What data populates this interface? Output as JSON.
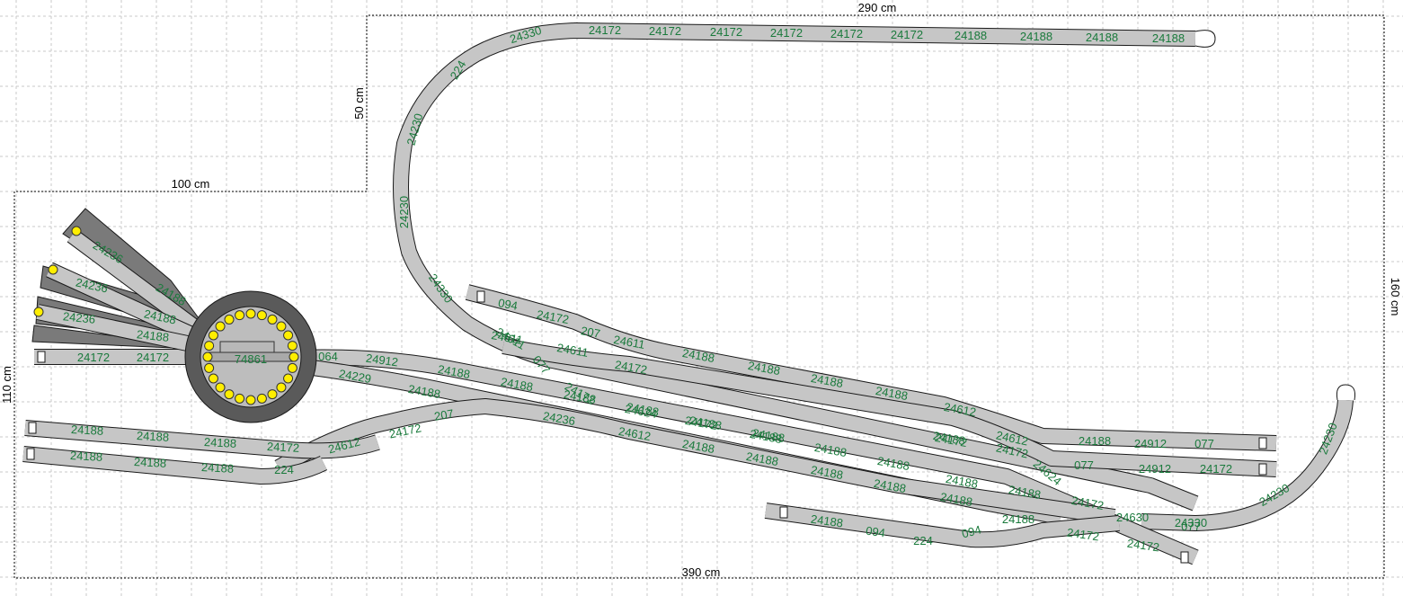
{
  "dimensions": {
    "top_width": "290 cm",
    "step_height": "50 cm",
    "step_width": "100 cm",
    "right_height": "160 cm",
    "left_height": "110 cm",
    "bottom_width": "390 cm"
  },
  "turntable": {
    "part": "74861"
  },
  "parts": {
    "top_loop": [
      "24330",
      "24172",
      "24172",
      "24172",
      "24172",
      "24172",
      "24172",
      "24188",
      "24188",
      "24188",
      "24188"
    ],
    "left_curve": [
      "224",
      "24230",
      "24230",
      "24330"
    ],
    "right_curve": [
      "24230",
      "24230",
      "24330"
    ],
    "fan": [
      "24236",
      "24188",
      "24236",
      "24188",
      "24236",
      "24188"
    ],
    "turntable_left": [
      "24172",
      "24172"
    ],
    "turntable_right": [
      "064",
      "24912",
      "24229"
    ],
    "yard_upper": [
      "094",
      "24172",
      "207",
      "24611",
      "24611",
      "24611",
      "077",
      "24612",
      "24612"
    ],
    "yard_main": [
      "24188",
      "24188",
      "24188",
      "24188",
      "24188",
      "24188",
      "24172",
      "24188",
      "24912",
      "077",
      "24236"
    ],
    "yard_second": [
      "24172",
      "24188",
      "24188",
      "24188",
      "24188",
      "24188",
      "24172",
      "24624",
      "077",
      "24912",
      "24172",
      "24172"
    ],
    "yard_third": [
      "24188",
      "24172",
      "24624",
      "24172",
      "24188",
      "24188",
      "24188",
      "24188",
      "24188",
      "24172",
      "24630",
      "077",
      "24330"
    ],
    "yard_fourth": [
      "24611",
      "24236",
      "24612",
      "24188",
      "24188",
      "24188",
      "24188",
      "24188",
      "24188",
      "24624"
    ],
    "left_sidings": [
      "24188",
      "24188",
      "24188",
      "24172",
      "24612",
      "24172",
      "207",
      "24188",
      "24188",
      "24188",
      "224"
    ],
    "bottom_siding": [
      "24188",
      "094",
      "224",
      "094",
      "24172",
      "24172"
    ]
  }
}
